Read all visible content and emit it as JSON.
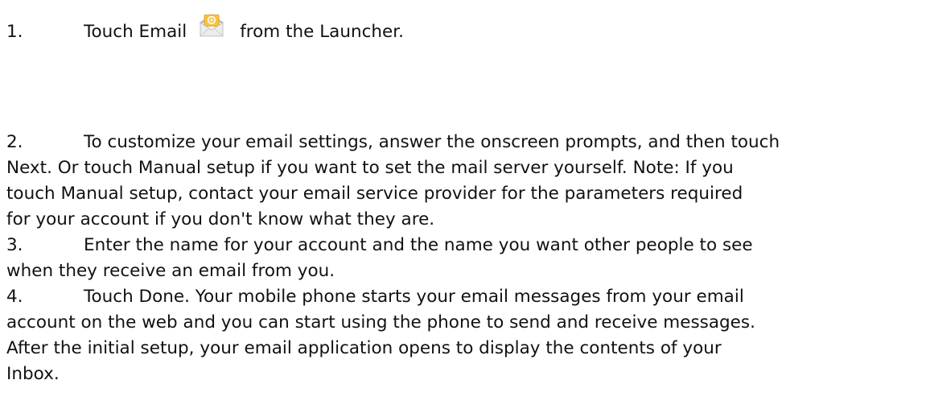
{
  "steps": [
    {
      "number": "1.",
      "text_before": "Touch Email",
      "icon": "email-app-icon",
      "text_after": "from the Launcher."
    },
    {
      "number": "2.",
      "lines": [
        "To customize your email settings, answer the onscreen prompts, and then touch",
        "Next. Or touch Manual setup if you want to set the mail server yourself. Note: If you",
        "touch Manual setup, contact your email service provider for the parameters required",
        "for your account if you don't know what they are."
      ]
    },
    {
      "number": "3.",
      "lines": [
        "Enter the name for your account and the name you want other people to see",
        "when they receive an email from you."
      ]
    },
    {
      "number": "4.",
      "lines": [
        "Touch Done. Your mobile phone starts your email messages from your email",
        "account on the web and you can start using the phone to send and receive messages.",
        "After the initial setup, your email application opens to display the contents of your",
        "Inbox."
      ]
    }
  ],
  "colors": {
    "text": "#111111",
    "icon_envelope": "#e9e9e9",
    "icon_at_symbol": "#f2a81d"
  }
}
